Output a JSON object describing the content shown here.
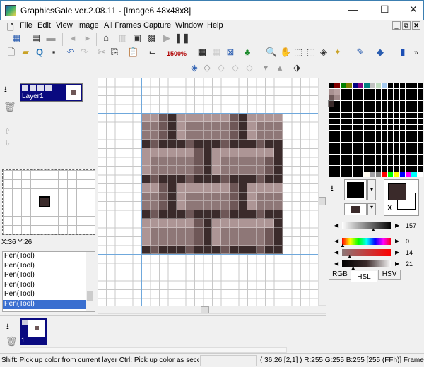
{
  "window": {
    "title": "GraphicsGale ver.2.08.11 - [Image6 48x48x8]",
    "minimize": "—",
    "maximize": "☐",
    "close": "✕"
  },
  "menu": [
    "File",
    "Edit",
    "View",
    "Image",
    "All Frames",
    "Capture",
    "Window",
    "Help"
  ],
  "mdi": {
    "minimize": "_",
    "restore": "⧉",
    "close": "✕"
  },
  "toolbar": {
    "zoom": "1500%",
    "more": "»"
  },
  "layers": {
    "name": "Layer1"
  },
  "preview": {
    "coords": "X:36 Y:26"
  },
  "history": [
    "Pen(Tool)",
    "Pen(Tool)",
    "Pen(Tool)",
    "Pen(Tool)",
    "Pen(Tool)",
    "Pen(Tool)"
  ],
  "frames": {
    "label": "1"
  },
  "colors": {
    "primary": "#000000",
    "secondary": "#3a2a2a",
    "accent_selected": "#0a0a80",
    "grid_line": "#6fa8dc",
    "swap_label": "X"
  },
  "sliders": {
    "gray": {
      "value": "157",
      "fraction": 0.62
    },
    "hue": {
      "value": "0",
      "fraction": 0.0
    },
    "sat": {
      "value": "14",
      "fraction": 0.14
    },
    "lum": {
      "value": "21",
      "fraction": 0.21
    }
  },
  "color_tabs": [
    "RGB",
    "HSL",
    "HSV"
  ],
  "active_color_tab": "HSL",
  "palette": {
    "row0": [
      "#000000",
      "#800000",
      "#008000",
      "#808000",
      "#000080",
      "#800080",
      "#008080",
      "#c0c0c0",
      "#c0dcc0",
      "#a6caf0"
    ],
    "row1": [
      "#a89090",
      "#b8a0a0"
    ],
    "row2": [
      "#6e5858",
      "#a08888"
    ],
    "row3": [
      "#3a2a2a"
    ],
    "last": [
      "#fffbf0",
      "#a0a0a4",
      "#808080",
      "#ff0000",
      "#00ff00",
      "#ffff00",
      "#0000ff",
      "#ff00ff",
      "#00ffff",
      "#ffffff"
    ]
  },
  "image": {
    "palette": {
      "L": "#ad9595",
      "M": "#8e7777",
      "S": "#6e5757",
      "D": "#3b2b2b"
    },
    "rows": [
      "LLSDLLLLLLSDLLLL",
      "MMSDLMMMMMSDLMMM",
      "MMSDLMMMMMSDLMMM",
      "DSDDDSDDDSDDDSDD",
      "LLLLLLSDLLLLLLLD",
      "LMMMMMSDLMMMMMSD",
      "LMMMMMSDLMMMMMSD",
      "DSDDDSDDDSDDDSDD",
      "LLSDLLLLLLSDLLLL",
      "MMSDLMMMMMSDLMMM",
      "MMSDLMMMMMSDLMMM",
      "DSDDDSDDDSDDDSDD",
      "LLLLLLSDLLLLLLLD",
      "LMMMMMSDLMMMMMSD",
      "LMMMMMSDLMMMMMSD",
      "DSDDDSDDDSDDDSDD"
    ]
  },
  "status": {
    "hint": "Shift: Pick up color from current layer  Ctrl: Pick up color as secc",
    "info": "( 36,26 [2,1] ) R:255 G:255 B:255  [255 (FFh)]  Frame"
  }
}
